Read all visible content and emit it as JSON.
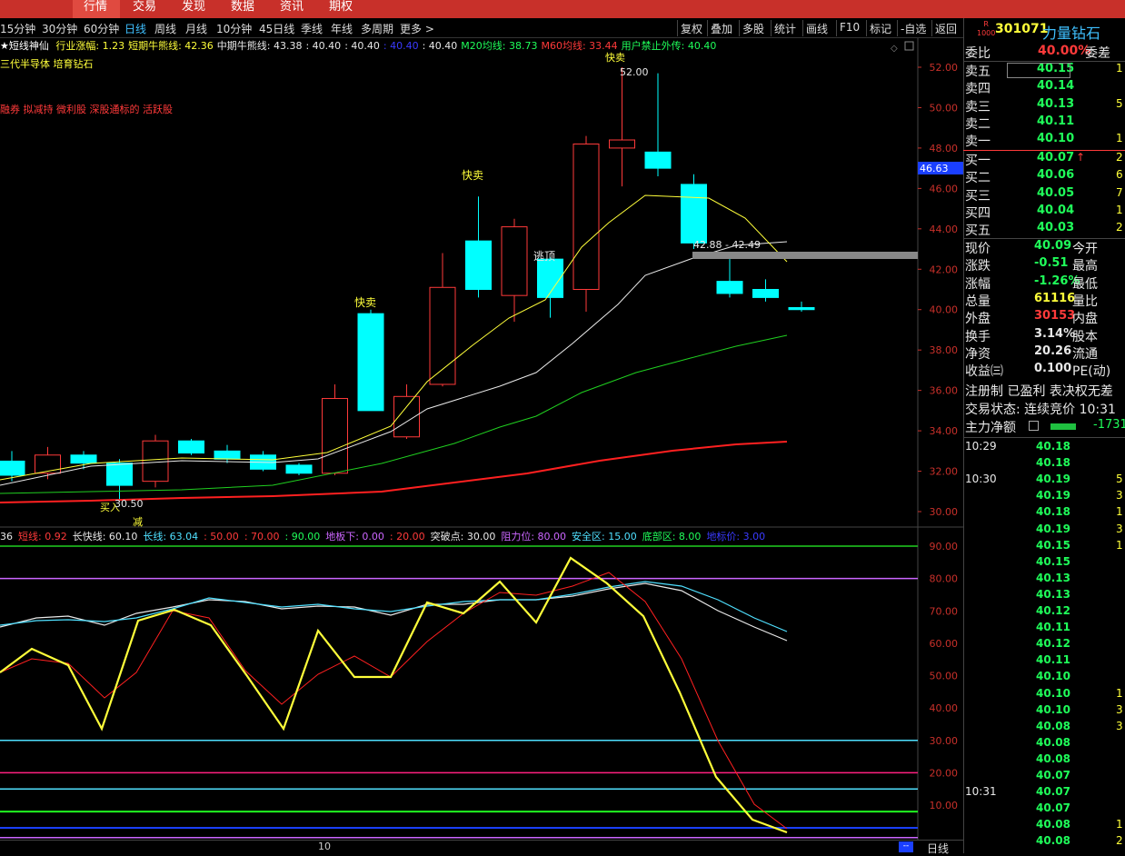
{
  "top_nav": [
    "行情",
    "交易",
    "发现",
    "数据",
    "资讯",
    "期权"
  ],
  "periods": [
    "15分钟",
    "30分钟",
    "60分钟",
    "日线",
    "周线",
    "月线",
    "10分钟",
    "45日线",
    "季线",
    "年线",
    "多周期",
    "更多 >"
  ],
  "active_period": "日线",
  "toolbar": [
    "复权",
    "叠加",
    "多股",
    "统计",
    "画线",
    "F10",
    "标记",
    "-自选",
    "返回"
  ],
  "indicator_header": {
    "name": "★短线神仙",
    "items": [
      {
        "text": "行业涨幅: 1.23",
        "color": "#ffff3a"
      },
      {
        "text": "短期牛熊线: 42.36",
        "color": "#ffff3a"
      },
      {
        "text": "中期牛熊线: 43.38",
        "color": "#e8e8e8"
      },
      {
        "text": ": 40.40",
        "color": "#e8e8e8"
      },
      {
        "text": ": 40.40",
        "color": "#e8e8e8"
      },
      {
        "text": ": 40.40",
        "color": "#3a3aff"
      },
      {
        "text": ": 40.40",
        "color": "#e8e8e8"
      },
      {
        "text": "M20均线: 38.73",
        "color": "#1fff5a"
      },
      {
        "text": "M60均线: 33.44",
        "color": "#ff3a3a"
      },
      {
        "text": "用户禁止外传: 40.40",
        "color": "#1fff5a"
      }
    ]
  },
  "stock_tags": {
    "line1": "三代半导体 培育钻石",
    "line2": "融券 拟减持 微利股 深股通标的 活跃股"
  },
  "price_axis": [
    "52.00",
    "50.00",
    "48.00",
    "46.00",
    "44.00",
    "42.00",
    "40.00",
    "38.00",
    "36.00",
    "34.00",
    "32.00",
    "30.00"
  ],
  "crosshair_price": "46.63",
  "chart_annotations": {
    "sell1": "快卖",
    "sell2": "快卖",
    "sell3": "快卖",
    "escape": "逃顶",
    "buy": "买入",
    "reduce": "减",
    "low_label": "30.50",
    "high_label": "52.00",
    "range_label": "42.88 - 42.49"
  },
  "sub_header": [
    {
      "text": "36",
      "color": "#e8e8e8"
    },
    {
      "text": "短线: 0.92",
      "color": "#ff3a3a"
    },
    {
      "text": "长快线: 60.10",
      "color": "#e8e8e8"
    },
    {
      "text": "长线: 63.04",
      "color": "#4fe0ff"
    },
    {
      "text": ": 50.00",
      "color": "#ff3a3a"
    },
    {
      "text": ": 70.00",
      "color": "#ff3a3a"
    },
    {
      "text": ": 90.00",
      "color": "#1fff5a"
    },
    {
      "text": "地板下: 0.00",
      "color": "#cc66ff"
    },
    {
      "text": ": 20.00",
      "color": "#ff3a3a"
    },
    {
      "text": "突破点: 30.00",
      "color": "#e8e8e8"
    },
    {
      "text": "阻力位: 80.00",
      "color": "#cc66ff"
    },
    {
      "text": "安全区: 15.00",
      "color": "#4fe0ff"
    },
    {
      "text": "底部区: 8.00",
      "color": "#1fff5a"
    },
    {
      "text": "地标价: 3.00",
      "color": "#3a3aff"
    }
  ],
  "sub_axis": [
    "90.00",
    "80.00",
    "70.00",
    "60.00",
    "50.00",
    "40.00",
    "30.00",
    "20.00",
    "10.00"
  ],
  "bottom": {
    "date_label": "10",
    "period_label": "日线",
    "scroll_label": "--"
  },
  "quote": {
    "code": "301071",
    "name": "力量钻石",
    "badge_top": "R",
    "badge_bottom": "1000",
    "wei_bi_label": "委比",
    "wei_bi": "40.00%",
    "wei_cha_label": "委差",
    "asks": [
      {
        "label": "卖五",
        "price": "40.15",
        "vol": "1"
      },
      {
        "label": "卖四",
        "price": "40.14",
        "vol": ""
      },
      {
        "label": "卖三",
        "price": "40.13",
        "vol": "5"
      },
      {
        "label": "卖二",
        "price": "40.11",
        "vol": ""
      },
      {
        "label": "卖一",
        "price": "40.10",
        "vol": "1"
      }
    ],
    "bids": [
      {
        "label": "买一",
        "price": "40.07",
        "vol": "2",
        "arrow": "↑"
      },
      {
        "label": "买二",
        "price": "40.06",
        "vol": "6",
        "arrow": ""
      },
      {
        "label": "买三",
        "price": "40.05",
        "vol": "7",
        "arrow": ""
      },
      {
        "label": "买四",
        "price": "40.04",
        "vol": "1",
        "arrow": ""
      },
      {
        "label": "买五",
        "price": "40.03",
        "vol": "2",
        "arrow": ""
      }
    ],
    "stats": [
      {
        "label": "现价",
        "value": "40.09",
        "color": "#1fff5a",
        "label2": "今开"
      },
      {
        "label": "涨跌",
        "value": "-0.51",
        "color": "#1fff5a",
        "label2": "最高"
      },
      {
        "label": "涨幅",
        "value": "-1.26%",
        "color": "#1fff5a",
        "label2": "最低"
      },
      {
        "label": "总量",
        "value": "61116",
        "color": "#ffff3a",
        "label2": "量比"
      },
      {
        "label": "外盘",
        "value": "30153",
        "color": "#ff3a3a",
        "label2": "内盘"
      },
      {
        "label": "换手",
        "value": "3.14%",
        "color": "#e8e8e8",
        "label2": "股本"
      },
      {
        "label": "净资",
        "value": "20.26",
        "color": "#e8e8e8",
        "label2": "流通"
      },
      {
        "label": "收益㈢",
        "value": "0.100",
        "color": "#e8e8e8",
        "label2": "PE(动)"
      }
    ],
    "reg_line": "注册制 已盈利 表决权无差",
    "trade_status": "交易状态: 连续竞价 10:31",
    "main_flow_label": "主力净额",
    "main_flow_value": "-1731"
  },
  "ticks": [
    {
      "time": "10:29",
      "price": "40.18",
      "vol": ""
    },
    {
      "time": "",
      "price": "40.18",
      "vol": ""
    },
    {
      "time": "10:30",
      "price": "40.19",
      "vol": "5"
    },
    {
      "time": "",
      "price": "40.19",
      "vol": "3"
    },
    {
      "time": "",
      "price": "40.18",
      "vol": "1"
    },
    {
      "time": "",
      "price": "40.19",
      "vol": "3"
    },
    {
      "time": "",
      "price": "40.15",
      "vol": "1"
    },
    {
      "time": "",
      "price": "40.15",
      "vol": ""
    },
    {
      "time": "",
      "price": "40.13",
      "vol": ""
    },
    {
      "time": "",
      "price": "40.13",
      "vol": ""
    },
    {
      "time": "",
      "price": "40.12",
      "vol": ""
    },
    {
      "time": "",
      "price": "40.11",
      "vol": ""
    },
    {
      "time": "",
      "price": "40.12",
      "vol": ""
    },
    {
      "time": "",
      "price": "40.11",
      "vol": ""
    },
    {
      "time": "",
      "price": "40.10",
      "vol": ""
    },
    {
      "time": "",
      "price": "40.10",
      "vol": "1"
    },
    {
      "time": "",
      "price": "40.10",
      "vol": "3"
    },
    {
      "time": "",
      "price": "40.08",
      "vol": "3"
    },
    {
      "time": "",
      "price": "40.08",
      "vol": ""
    },
    {
      "time": "",
      "price": "40.08",
      "vol": ""
    },
    {
      "time": "",
      "price": "40.07",
      "vol": ""
    },
    {
      "time": "10:31",
      "price": "40.07",
      "vol": ""
    },
    {
      "time": "",
      "price": "40.07",
      "vol": ""
    },
    {
      "time": "",
      "price": "40.08",
      "vol": "1"
    },
    {
      "time": "",
      "price": "40.08",
      "vol": "2"
    }
  ],
  "candles": [
    {
      "o": 32.5,
      "c": 31.8,
      "h": 33.0,
      "l": 31.5
    },
    {
      "o": 31.9,
      "c": 32.8,
      "h": 33.2,
      "l": 31.6
    },
    {
      "o": 32.8,
      "c": 32.4,
      "h": 33.0,
      "l": 32.1
    },
    {
      "o": 32.4,
      "c": 31.3,
      "h": 32.6,
      "l": 30.5
    },
    {
      "o": 31.5,
      "c": 33.5,
      "h": 33.8,
      "l": 31.2
    },
    {
      "o": 33.5,
      "c": 32.9,
      "h": 33.6,
      "l": 32.8
    },
    {
      "o": 33.0,
      "c": 32.6,
      "h": 33.3,
      "l": 32.4
    },
    {
      "o": 32.8,
      "c": 32.1,
      "h": 33.0,
      "l": 32.0
    },
    {
      "o": 32.3,
      "c": 31.9,
      "h": 32.4,
      "l": 31.8
    },
    {
      "o": 31.9,
      "c": 35.6,
      "h": 36.3,
      "l": 31.8
    },
    {
      "o": 39.8,
      "c": 35.0,
      "h": 40.0,
      "l": 35.0
    },
    {
      "o": 33.7,
      "c": 35.7,
      "h": 36.3,
      "l": 33.6
    },
    {
      "o": 36.3,
      "c": 41.1,
      "h": 42.8,
      "l": 36.2
    },
    {
      "o": 43.4,
      "c": 41.0,
      "h": 45.6,
      "l": 40.6
    },
    {
      "o": 40.7,
      "c": 44.1,
      "h": 44.5,
      "l": 39.4
    },
    {
      "o": 42.5,
      "c": 40.6,
      "h": 42.6,
      "l": 39.6
    },
    {
      "o": 41.0,
      "c": 48.2,
      "h": 48.6,
      "l": 39.9
    },
    {
      "o": 48.0,
      "c": 48.4,
      "h": 52.0,
      "l": 46.1
    },
    {
      "o": 47.8,
      "c": 47.0,
      "h": 51.7,
      "l": 46.6
    },
    {
      "o": 46.2,
      "c": 43.3,
      "h": 46.7,
      "l": 43.0
    },
    {
      "o": 41.4,
      "c": 40.8,
      "h": 42.5,
      "l": 40.6
    },
    {
      "o": 41.0,
      "c": 40.6,
      "h": 41.5,
      "l": 40.4
    },
    {
      "o": 40.1,
      "c": 40.0,
      "h": 40.4,
      "l": 39.9
    }
  ]
}
